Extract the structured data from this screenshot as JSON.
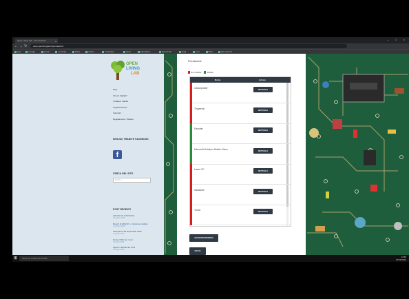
{
  "browser": {
    "tab_title": "Open Living Lab – Prenotazioni",
    "url": "www.openlivinglab.it/prenotazioni",
    "bookmarks": [
      "App",
      "Google",
      "Gmail",
      "YouTube",
      "Maps",
      "Notizie",
      "Traduttore",
      "Drive",
      "Calendario",
      "Documenti",
      "Fogli",
      "Foto",
      "Meet",
      "Altri preferiti"
    ],
    "ext_colors": [
      "#e94235",
      "#34a853",
      "#fbbc05",
      "#4285f4"
    ]
  },
  "sidebar": {
    "logo_line1": "OPEN",
    "logo_line2": "LIVING",
    "logo_line3": "LAB",
    "menu": [
      "FAQ",
      "Chi è il Fablab?",
      "Il Makers Fablab",
      "Organizzazione",
      "Volontari",
      "Regolamento / Statuto"
    ],
    "follow_heading": "SEGUICI TRAMITE FACEBOOK",
    "fb_icon": "f",
    "search_heading": "CERCA NEL SITO",
    "search_placeholder": "Cerca ...",
    "recent_heading": "POST RECENTI",
    "recent_posts": [
      {
        "title": "Laboratorio di Robotica",
        "date": "15 agosto 2022"
      },
      {
        "title": "Report di 2022-23 – Fai-da-te creativo",
        "date": "11 agosto 2022"
      },
      {
        "title": "Stampante 3D disponibile 2022",
        "date": "5 agosto 2022"
      },
      {
        "title": "Nuova CNC per i soci",
        "date": "26 luglio 2022"
      },
      {
        "title": "Aperto il bando dei corsi",
        "date": "18 luglio 2022"
      }
    ]
  },
  "content": {
    "section_title": "Prenotazioni",
    "legend_busy": "Non visibile",
    "legend_free": "Visibile",
    "col_name": "Nome",
    "col_action": "Azione",
    "colors": {
      "busy": "#d21f1f",
      "free": "#2e8b3d",
      "dark": "#2f3a45"
    },
    "rows": [
      {
        "name": "Cartonplotter",
        "action": "DETTAGLI",
        "status": "busy"
      },
      {
        "name": "Thayersal",
        "action": "DETTAGLI",
        "status": "busy"
      },
      {
        "name": "Decoder",
        "action": "DETTAGLI",
        "status": "free"
      },
      {
        "name": "Microsoft Hololens Mobile Vision",
        "action": "DETTAGLI",
        "status": "free"
      },
      {
        "name": "Laser-CO",
        "action": "DETTAGLI",
        "status": "busy"
      },
      {
        "name": "Saldatrice",
        "action": "DETTAGLI",
        "status": "busy"
      },
      {
        "name": "Tornio",
        "action": "DETTAGLI",
        "status": "busy"
      }
    ],
    "btn_add": "AGGIUNGI RISORSA",
    "btn_save": "SALVA"
  },
  "taskbar": {
    "search_text": "Scrivi qui il testo da cercare",
    "time": "14:50",
    "date": "15/09/2022",
    "app_colors": [
      "#888",
      "#4285f4",
      "#e0a030",
      "#ddd",
      "#1e88e5",
      "#d44",
      "#3a8",
      "#c62"
    ]
  }
}
